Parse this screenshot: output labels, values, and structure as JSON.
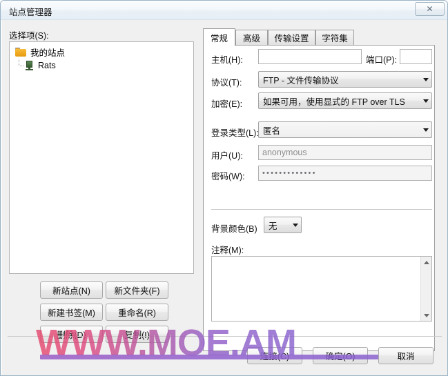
{
  "window": {
    "title": "站点管理器",
    "close_label": "✕"
  },
  "left": {
    "select_label": "选择项(S):",
    "tree": [
      {
        "label": "我的站点",
        "icon": "folder-icon",
        "level": 0
      },
      {
        "label": "Rats",
        "icon": "server-icon",
        "level": 1
      }
    ],
    "buttons": [
      {
        "label": "新站点(N)",
        "name": "new-site-button"
      },
      {
        "label": "新文件夹(F)",
        "name": "new-folder-button"
      },
      {
        "label": "新建书签(M)",
        "name": "new-bookmark-button"
      },
      {
        "label": "重命名(R)",
        "name": "rename-button"
      },
      {
        "label": "删除(D)",
        "name": "delete-button"
      },
      {
        "label": "复制(I)",
        "name": "duplicate-button"
      }
    ]
  },
  "tabs": [
    {
      "label": "常规",
      "active": true
    },
    {
      "label": "高级",
      "active": false
    },
    {
      "label": "传输设置",
      "active": false
    },
    {
      "label": "字符集",
      "active": false
    }
  ],
  "general": {
    "host_label": "主机(H):",
    "host_value": "",
    "port_label": "端口(P):",
    "port_value": "",
    "protocol_label": "协议(T):",
    "protocol_value": "FTP - 文件传输协议",
    "encryption_label": "加密(E):",
    "encryption_value": "如果可用，使用显式的 FTP over TLS",
    "logon_type_label": "登录类型(L):",
    "logon_type_value": "匿名",
    "user_label": "用户(U):",
    "user_value": "anonymous",
    "password_label": "密码(W):",
    "password_value": "•••••••••••••",
    "bgcolor_label": "背景颜色(B)",
    "bgcolor_value": "无",
    "comments_label": "注释(M):",
    "comments_value": ""
  },
  "bottom": {
    "connect_label": "连接(C)",
    "ok_label": "确定(O)",
    "cancel_label": "取消"
  },
  "watermark": {
    "text": "WWW.MOE.AM"
  }
}
